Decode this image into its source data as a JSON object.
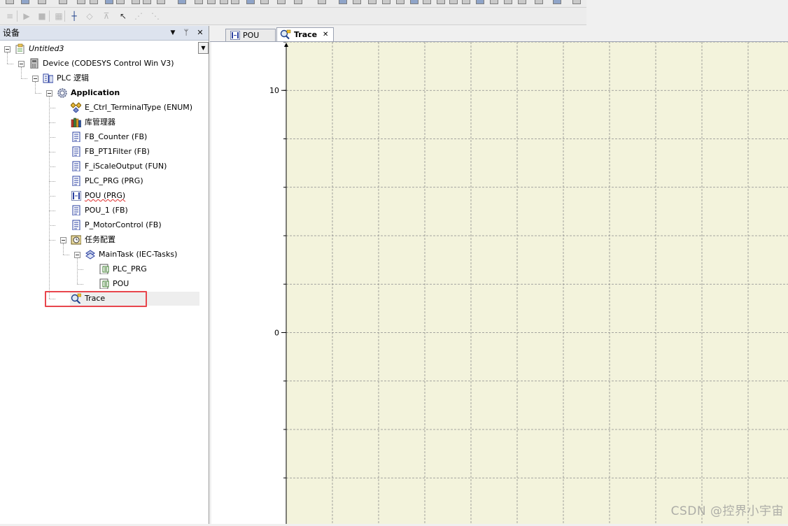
{
  "devices_pane": {
    "title": "设备",
    "menu_glyph": "▼",
    "pin_glyph": "ᛘ",
    "close_glyph": "✕",
    "scroll_glyph": "▼"
  },
  "tree": [
    {
      "id": "untitled3",
      "label": "Untitled3",
      "level": 0,
      "italic": true,
      "icon": "project-icon",
      "expand": true
    },
    {
      "id": "device",
      "label": "Device (CODESYS Control Win V3)",
      "level": 1,
      "icon": "device-icon",
      "expand": true
    },
    {
      "id": "plc-logic",
      "label": "PLC 逻辑",
      "level": 2,
      "icon": "plc-logic-icon",
      "expand": true
    },
    {
      "id": "application",
      "label": "Application",
      "level": 3,
      "bold": true,
      "icon": "application-gear-icon",
      "expand": true
    },
    {
      "id": "e-ctrl-terminaltype",
      "label": "E_Ctrl_TerminalType (ENUM)",
      "level": 4,
      "icon": "enum-icon"
    },
    {
      "id": "library-manager",
      "label": "库管理器",
      "level": 4,
      "icon": "library-manager-icon"
    },
    {
      "id": "fb-counter",
      "label": "FB_Counter (FB)",
      "level": 4,
      "icon": "pou-document-icon"
    },
    {
      "id": "fb-pt1filter",
      "label": "FB_PT1Filter (FB)",
      "level": 4,
      "icon": "pou-document-icon"
    },
    {
      "id": "f-iscaleoutput",
      "label": "F_iScaleOutput (FUN)",
      "level": 4,
      "icon": "pou-document-icon"
    },
    {
      "id": "plc-prg",
      "label": "PLC_PRG (PRG)",
      "level": 4,
      "icon": "pou-document-icon"
    },
    {
      "id": "pou-prg",
      "label": "POU (PRG)",
      "level": 4,
      "icon": "ladder-pou-icon",
      "spellcheck": true
    },
    {
      "id": "pou-1",
      "label": "POU_1 (FB)",
      "level": 4,
      "icon": "pou-document-icon"
    },
    {
      "id": "p-motorcontrol",
      "label": "P_MotorControl (FB)",
      "level": 4,
      "icon": "pou-document-icon"
    },
    {
      "id": "task-config",
      "label": "任务配置",
      "level": 4,
      "icon": "task-configuration-icon",
      "expand": true
    },
    {
      "id": "maintask",
      "label": "MainTask (IEC-Tasks)",
      "level": 5,
      "icon": "task-icon",
      "expand": true
    },
    {
      "id": "call-plc-prg",
      "label": "PLC_PRG",
      "level": 6,
      "icon": "program-call-icon"
    },
    {
      "id": "call-pou",
      "label": "POU",
      "level": 6,
      "icon": "program-call-icon"
    },
    {
      "id": "trace",
      "label": "Trace",
      "level": 4,
      "icon": "trace-icon"
    }
  ],
  "tabs": [
    {
      "id": "pou",
      "label": "POU",
      "icon": "ladder-pou-icon",
      "active": false
    },
    {
      "id": "trace",
      "label": "Trace",
      "icon": "trace-icon",
      "active": true,
      "close_glyph": "✕"
    }
  ],
  "chart_data": {
    "type": "line",
    "title": "",
    "xlabel": "",
    "ylabel": "",
    "ylim": [
      -7.9,
      12
    ],
    "y_ticks": [
      10,
      0
    ],
    "y_minor_tick_step": 2,
    "grid": true,
    "series": [],
    "colors": {
      "plot_background": "#f3f3dc",
      "grid": "#8c8c8c",
      "axis": "#000000"
    }
  },
  "watermark": "CSDN @控界小宇宙"
}
